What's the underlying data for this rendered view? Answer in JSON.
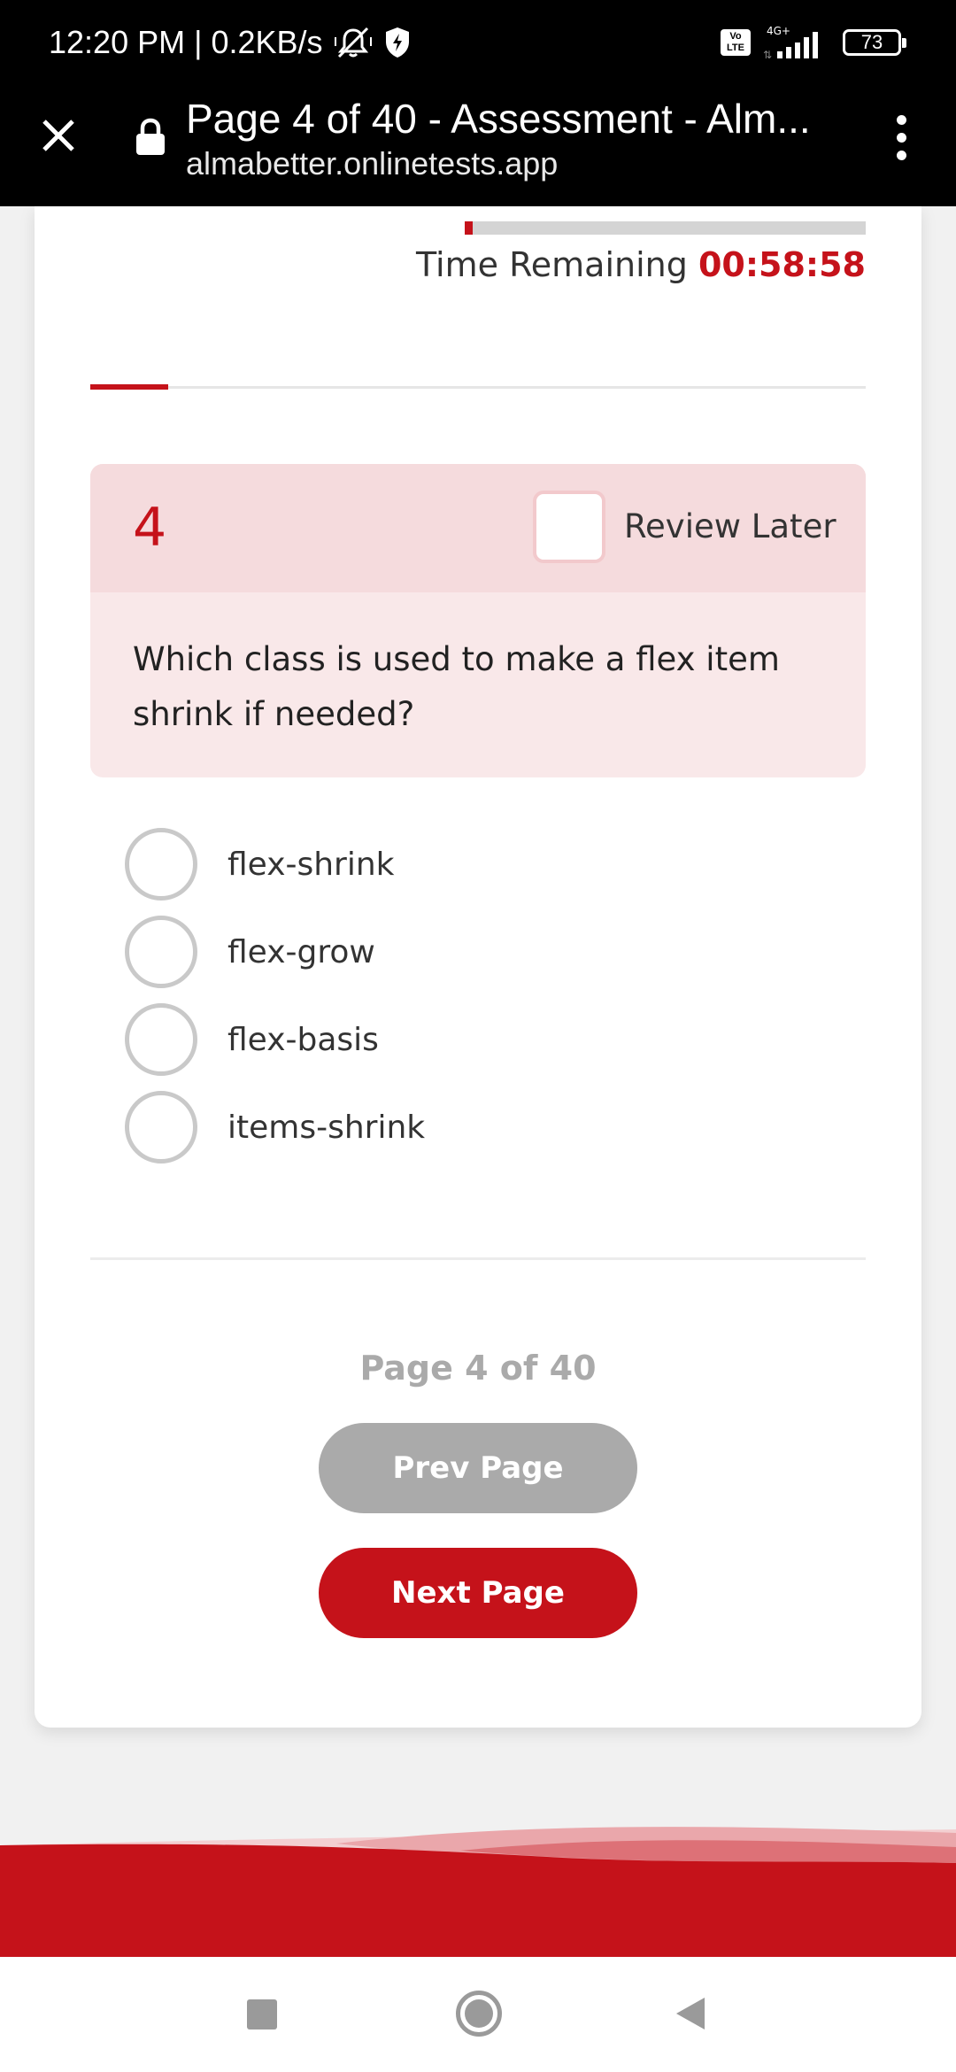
{
  "status_bar": {
    "time_speed": "12:20 PM | 0.2KB/s",
    "network_badge": "Vo LTE",
    "network_type": "4G+",
    "battery": "73",
    "icons": [
      "mute-icon",
      "shield-icon",
      "signal-icon",
      "battery-icon"
    ]
  },
  "browser": {
    "title": "Page 4 of 40 - Assessment - Alm...",
    "host": "almabetter.onlinetests.app"
  },
  "timer": {
    "label": "Time Remaining ",
    "value": "00:58:58",
    "elapsed_fraction": 0.02
  },
  "progress": {
    "fraction": 0.1
  },
  "question": {
    "number": "4",
    "review_label": "Review Later",
    "review_checked": false,
    "text": "Which class is used to make a flex item shrink if needed?",
    "options": [
      {
        "label": "flex-shrink",
        "selected": false
      },
      {
        "label": "flex-grow",
        "selected": false
      },
      {
        "label": "flex-basis",
        "selected": false
      },
      {
        "label": "items-shrink",
        "selected": false
      }
    ]
  },
  "pagination": {
    "indicator": "Page 4 of 40",
    "prev_label": "Prev Page",
    "next_label": "Next Page"
  },
  "colors": {
    "accent": "#c5121a",
    "disabled": "#aaaaaa",
    "question_header_bg": "#f5dbdd",
    "question_body_bg": "#f9e8e9"
  }
}
